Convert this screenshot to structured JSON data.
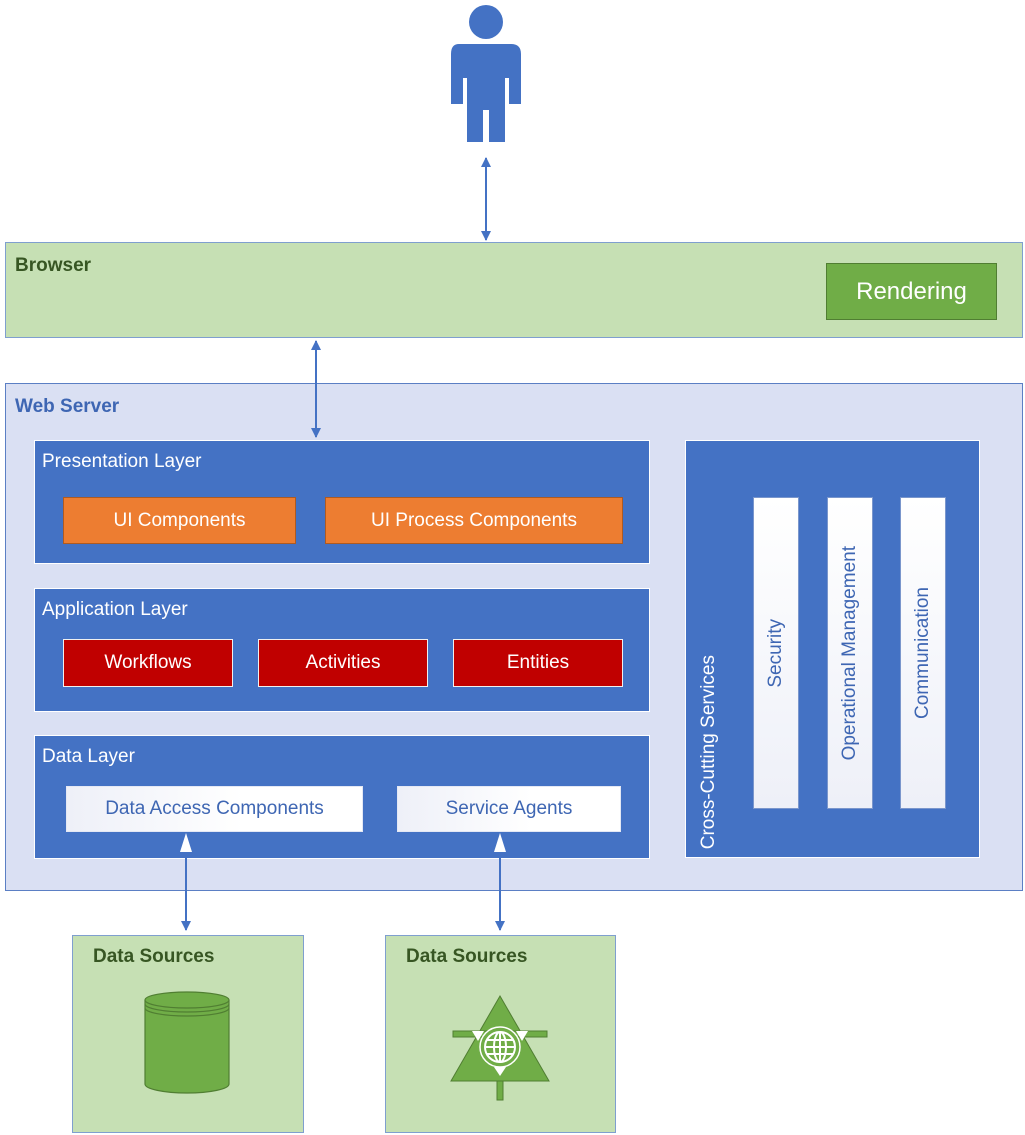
{
  "diagram": {
    "user": {
      "icon": "person-icon"
    },
    "browser": {
      "title": "Browser",
      "components": [
        "Rendering"
      ]
    },
    "web_server": {
      "title": "Web Server",
      "presentation_layer": {
        "title": "Presentation Layer",
        "components": [
          "UI Components",
          "UI Process Components"
        ]
      },
      "application_layer": {
        "title": "Application Layer",
        "components": [
          "Workflows",
          "Activities",
          "Entities"
        ]
      },
      "data_layer": {
        "title": "Data Layer",
        "components": [
          "Data Access Components",
          "Service Agents"
        ]
      },
      "cross_cutting": {
        "title": "Cross-Cutting Services",
        "components": [
          "Security",
          "Operational Management",
          "Communication"
        ]
      }
    },
    "data_sources": [
      {
        "title": "Data Sources",
        "icon": "database-icon"
      },
      {
        "title": "Data Sources",
        "icon": "web-service-icon"
      }
    ],
    "connectors": [
      {
        "from": "user",
        "to": "browser",
        "type": "bidirectional"
      },
      {
        "from": "browser",
        "to": "presentation_layer",
        "type": "bidirectional"
      },
      {
        "from": "data_access_components",
        "to": "data_sources_1",
        "type": "bidirectional"
      },
      {
        "from": "service_agents",
        "to": "data_sources_2",
        "type": "bidirectional"
      }
    ],
    "colors": {
      "accent_blue": "#4472c4",
      "browser_green": "#c6e0b4",
      "component_green": "#70ad47",
      "ui_orange": "#ed7d31",
      "app_red": "#c00000",
      "server_bg": "#dae0f3"
    }
  }
}
